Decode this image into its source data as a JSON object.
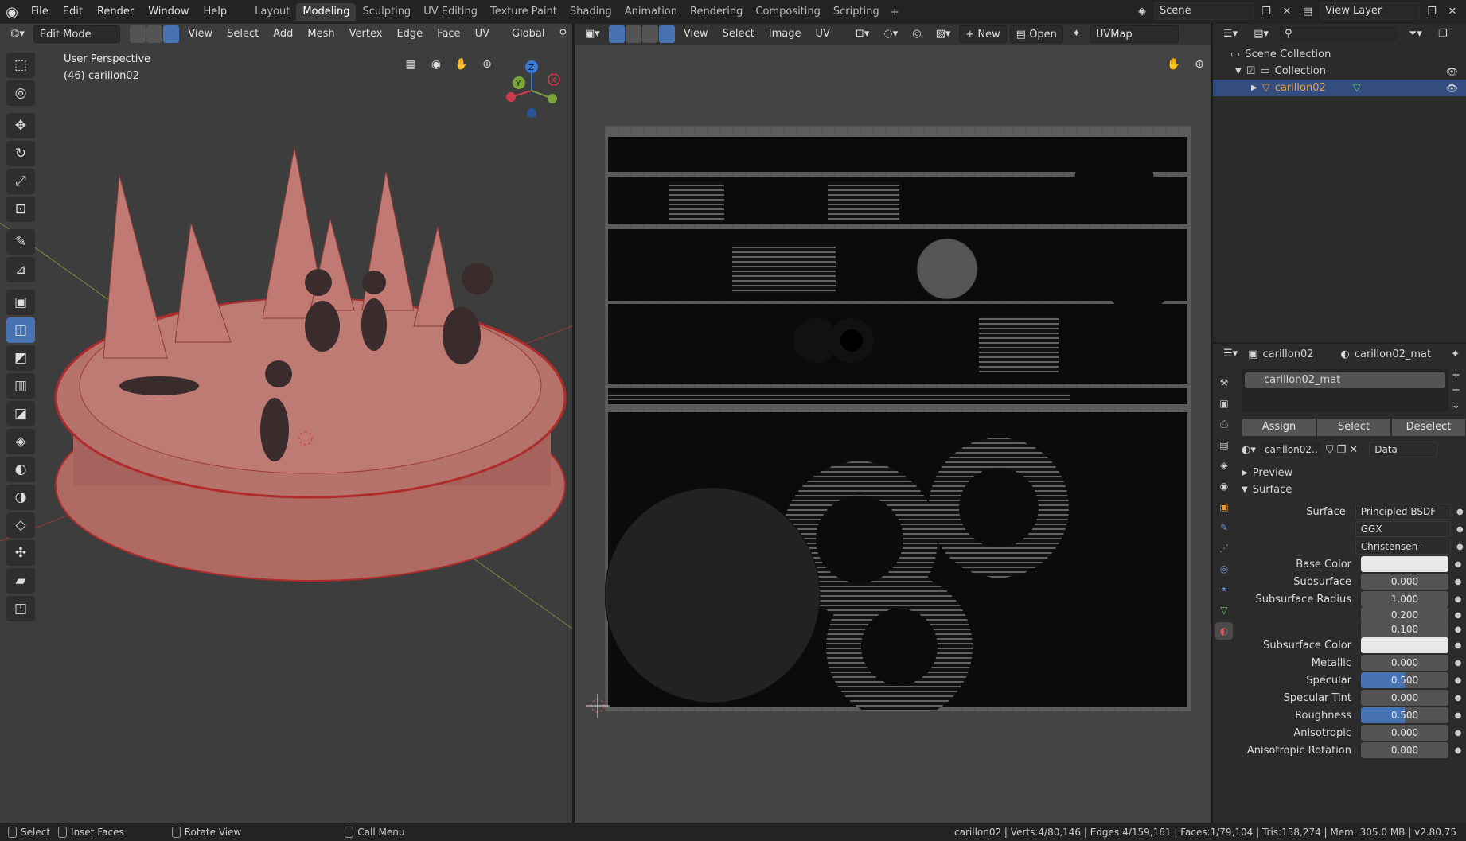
{
  "menu": [
    "File",
    "Edit",
    "Render",
    "Window",
    "Help"
  ],
  "workspaces": [
    "Layout",
    "Modeling",
    "Sculpting",
    "UV Editing",
    "Texture Paint",
    "Shading",
    "Animation",
    "Rendering",
    "Compositing",
    "Scripting"
  ],
  "active_workspace": "Modeling",
  "scene_name": "Scene",
  "view_layer": "View Layer",
  "viewport": {
    "mode": "Edit Mode",
    "menus": [
      "View",
      "Select",
      "Add",
      "Mesh",
      "Vertex",
      "Edge",
      "Face",
      "UV"
    ],
    "orientation": "Global",
    "perspective": "User Perspective",
    "object_label": "(46) carillon02",
    "gizmo_x": "X",
    "gizmo_y": "Y",
    "gizmo_z": "Z"
  },
  "uv_editor": {
    "menus": [
      "View",
      "Select",
      "Image",
      "UV"
    ],
    "new": "New",
    "open": "Open",
    "uvmap": "UVMap"
  },
  "outliner": {
    "root": "Scene Collection",
    "collection": "Collection",
    "object": "carillon02"
  },
  "properties": {
    "object": "carillon02",
    "material": "carillon02_mat",
    "slot": "carillon02_mat",
    "assign": "Assign",
    "select": "Select",
    "deselect": "Deselect",
    "mat_field": "carillon02..",
    "data": "Data",
    "preview": "Preview",
    "surface_panel": "Surface",
    "rows": [
      {
        "label": "Surface",
        "value": "Principled BSDF",
        "kind": "dd"
      },
      {
        "label": "",
        "value": "GGX",
        "kind": "dd"
      },
      {
        "label": "",
        "value": "Christensen-Burley",
        "kind": "dd"
      },
      {
        "label": "Base Color",
        "value": "",
        "kind": "white"
      },
      {
        "label": "Subsurface",
        "value": "0.000",
        "kind": "num"
      },
      {
        "label": "Subsurface Radius",
        "value": "1.000",
        "kind": "num"
      },
      {
        "label": "",
        "value": "0.200",
        "kind": "num"
      },
      {
        "label": "",
        "value": "0.100",
        "kind": "num"
      },
      {
        "label": "Subsurface Color",
        "value": "",
        "kind": "white"
      },
      {
        "label": "Metallic",
        "value": "0.000",
        "kind": "num"
      },
      {
        "label": "Specular",
        "value": "0.500",
        "kind": "blue"
      },
      {
        "label": "Specular Tint",
        "value": "0.000",
        "kind": "num"
      },
      {
        "label": "Roughness",
        "value": "0.500",
        "kind": "blue"
      },
      {
        "label": "Anisotropic",
        "value": "0.000",
        "kind": "num"
      },
      {
        "label": "Anisotropic Rotation",
        "value": "0.000",
        "kind": "num"
      }
    ]
  },
  "status": {
    "select": "Select",
    "inset": "Inset Faces",
    "rotate": "Rotate View",
    "menu": "Call Menu",
    "stats": "carillon02 | Verts:4/80,146 | Edges:4/159,161 | Faces:1/79,104 | Tris:158,274 | Mem: 305.0 MB | v2.80.75"
  }
}
